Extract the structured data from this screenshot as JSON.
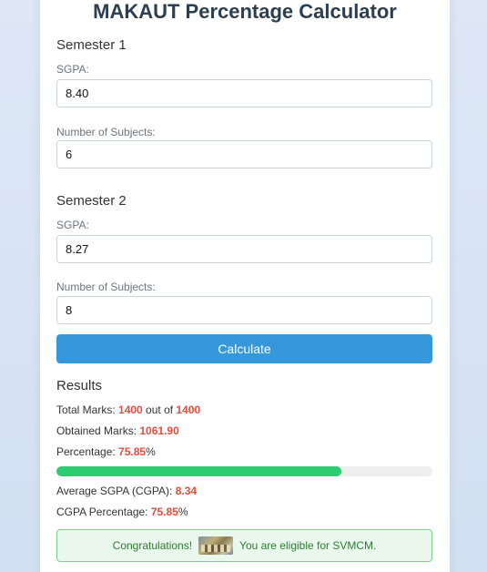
{
  "header": {
    "title": "MAKAUT Percentage Calculator"
  },
  "semesters": [
    {
      "title": "Semester 1",
      "sgpa_label": "SGPA:",
      "sgpa_value": "8.40",
      "subjects_label": "Number of Subjects:",
      "subjects_value": "6"
    },
    {
      "title": "Semester 2",
      "sgpa_label": "SGPA:",
      "sgpa_value": "8.27",
      "subjects_label": "Number of Subjects:",
      "subjects_value": "8"
    }
  ],
  "actions": {
    "calculate_label": "Calculate"
  },
  "results": {
    "title": "Results",
    "total_marks_label": "Total Marks: ",
    "total_marks_value": "1400",
    "out_of_text": " out of ",
    "total_max_value": "1400",
    "obtained_label": "Obtained Marks: ",
    "obtained_value": "1061.90",
    "percentage_label": "Percentage: ",
    "percentage_value": "75.85",
    "percent_sign": "%",
    "progress_percent": 75.85,
    "cgpa_label": "Average SGPA (CGPA): ",
    "cgpa_value": "8.34",
    "cgpa_percentage_label": "CGPA Percentage: ",
    "cgpa_percentage_value": "75.85",
    "cgpa_percent_sign": "%"
  },
  "eligibility": {
    "prefix": "Congratulations!",
    "suffix": "You are eligible for SVMCM.",
    "image_icon": "celebration-image"
  },
  "colors": {
    "accent_button": "#3498db",
    "highlight_red": "#e74c3c",
    "progress_green": "#2ecc71",
    "success_text": "#2e7d32"
  }
}
